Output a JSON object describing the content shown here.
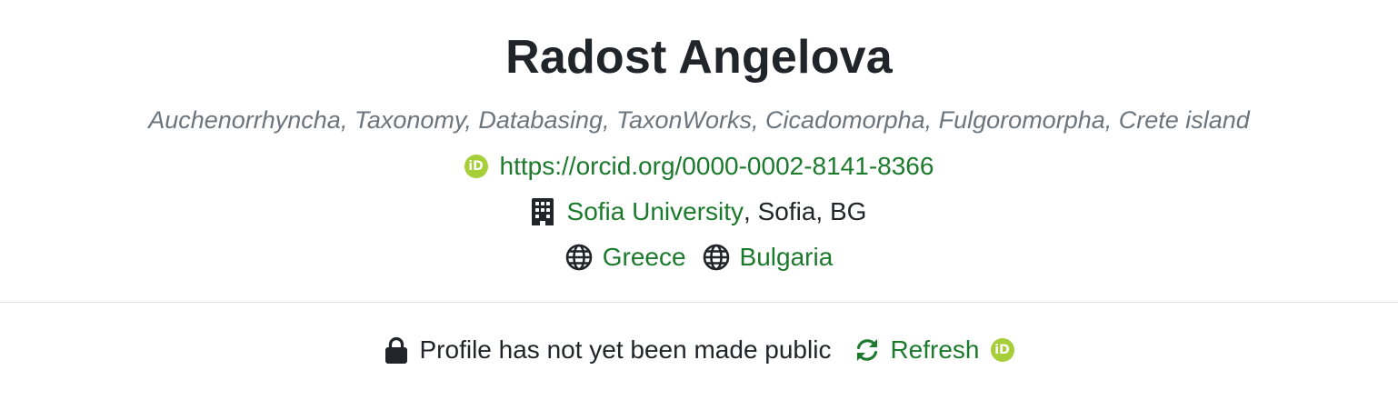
{
  "profile": {
    "name": "Radost Angelova",
    "keywords": "Auchenorrhyncha, Taxonomy, Databasing, TaxonWorks, Cicadomorpha, Fulgoromorpha, Crete island",
    "orcid_url": "https://orcid.org/0000-0002-8141-8366",
    "institution": {
      "name": "Sofia University",
      "location": ", Sofia, BG"
    },
    "countries": [
      "Greece",
      "Bulgaria"
    ]
  },
  "status": {
    "message": "Profile has not yet been made public",
    "refresh_label": "Refresh"
  },
  "icons": {
    "orcid": "orcid-icon",
    "institution": "building-icon",
    "country": "globe-icon",
    "status": "lock-icon",
    "refresh": "refresh-icon"
  },
  "colors": {
    "link": "#1b7a2c",
    "keywords": "#6c757d",
    "text": "#212529",
    "orcid": "#a6ce39",
    "divider": "#dee2e6"
  }
}
